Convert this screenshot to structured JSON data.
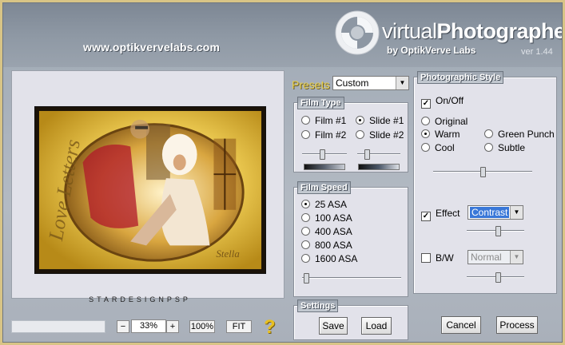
{
  "header": {
    "website": "www.optikvervelabs.com",
    "title_regular": "virtual",
    "title_bold": "Photographer",
    "byline": "by OptikVerve Labs",
    "version": "ver 1.44"
  },
  "preview": {
    "caption": "STARDESIGNPSP",
    "zoom": {
      "minus_label": "−",
      "value": "33%",
      "plus_label": "+",
      "reset_label": "100%",
      "fit_label": "FIT"
    },
    "help_symbol": "?"
  },
  "presets": {
    "label": "Presets",
    "selected": "Custom"
  },
  "film_type": {
    "title": "Film Type",
    "options": [
      "Film #1",
      "Slide #1",
      "Film #2",
      "Slide #2"
    ],
    "selected": "Slide #1",
    "slider1_value": 0.45,
    "slider2_value": 0.2
  },
  "film_speed": {
    "title": "Film Speed",
    "options": [
      "25 ASA",
      "100 ASA",
      "400 ASA",
      "800 ASA",
      "1600 ASA"
    ],
    "selected": "25 ASA",
    "slider_value": 0.02
  },
  "settings": {
    "title": "Settings",
    "save_label": "Save",
    "load_label": "Load"
  },
  "style": {
    "title": "Photographic Style",
    "onoff_label": "On/Off",
    "onoff_checked": true,
    "options": [
      "Original",
      "Warm",
      "Green Punch",
      "Cool",
      "Subtle"
    ],
    "selected": "Warm",
    "slider_value": 0.5,
    "effect_label": "Effect",
    "effect_checked": true,
    "effect_value": "Contrast",
    "effect_slider_value": 0.55,
    "bw_label": "B/W",
    "bw_checked": false,
    "bw_value": "Normal",
    "bw_slider_value": 0.55
  },
  "actions": {
    "cancel_label": "Cancel",
    "process_label": "Process"
  },
  "colors": {
    "title_bar": "#3a78d8",
    "presets_label": "#e8d050",
    "help_icon": "#e8c020"
  }
}
